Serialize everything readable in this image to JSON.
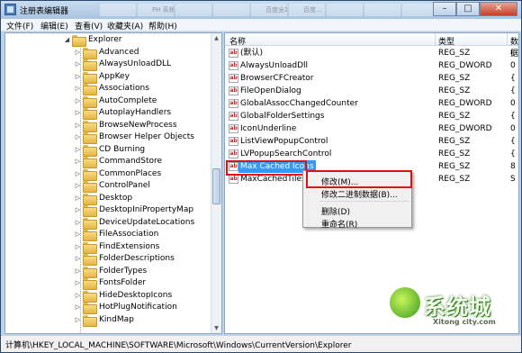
{
  "window": {
    "title": "注册表编辑器",
    "blurred_tabs": [
      "",
      "PH  系统工具",
      "",
      "",
      "百度全站",
      "百度...",
      "",
      "",
      ""
    ],
    "controls": {
      "minimize": "–",
      "maximize": "□",
      "close": "✕"
    }
  },
  "menubar": {
    "items": [
      "文件(F)",
      "编辑(E)",
      "查看(V)",
      "收藏夹(A)",
      "帮助(H)"
    ]
  },
  "tree": {
    "parent": "Explorer",
    "children": [
      "Advanced",
      "AlwaysUnloadDLL",
      "AppKey",
      "Associations",
      "AutoComplete",
      "AutoplayHandlers",
      "BrowseNewProcess",
      "Browser Helper Objects",
      "CD Burning",
      "CommandStore",
      "CommonPlaces",
      "ControlPanel",
      "Desktop",
      "DesktopIniPropertyMap",
      "DeviceUpdateLocations",
      "FileAssociation",
      "FindExtensions",
      "FolderDescriptions",
      "FolderTypes",
      "FontsFolder",
      "HideDesktopIcons",
      "HotPlugNotification",
      "KindMap"
    ]
  },
  "list": {
    "columns": {
      "name": "名称",
      "type": "类型",
      "data": "数据"
    },
    "rows": [
      {
        "name": "(默认)",
        "type": "REG_SZ",
        "data": "("
      },
      {
        "name": "AlwaysUnloadDll",
        "type": "REG_DWORD",
        "data": "0"
      },
      {
        "name": "BrowserCFCreator",
        "type": "REG_SZ",
        "data": "{"
      },
      {
        "name": "FileOpenDialog",
        "type": "REG_SZ",
        "data": "{"
      },
      {
        "name": "GlobalAssocChangedCounter",
        "type": "REG_DWORD",
        "data": "0"
      },
      {
        "name": "GlobalFolderSettings",
        "type": "REG_SZ",
        "data": "{"
      },
      {
        "name": "IconUnderline",
        "type": "REG_DWORD",
        "data": "0"
      },
      {
        "name": "ListViewPopupControl",
        "type": "REG_SZ",
        "data": "{"
      },
      {
        "name": "LVPopupSearchControl",
        "type": "REG_SZ",
        "data": "{"
      },
      {
        "name": "Max Cached Icons",
        "type": "REG_SZ",
        "data": "8"
      },
      {
        "name": "MaxCachedTiles",
        "type": "REG_SZ",
        "data": "S"
      }
    ],
    "selected_index": 9
  },
  "context_menu": {
    "items": [
      "修改(M)...",
      "修改二进制数据(B)...",
      "删除(D)",
      "重命名(R)"
    ]
  },
  "statusbar": {
    "path": "计算机\\HKEY_LOCAL_MACHINE\\SOFTWARE\\Microsoft\\Windows\\CurrentVersion\\Explorer"
  },
  "watermark": {
    "brand": "系统城",
    "url": "Xitong city.com"
  },
  "colors": {
    "selection": "#3399ff",
    "highlight_box": "#dd1111",
    "window_frame": "#bcd3ec"
  }
}
